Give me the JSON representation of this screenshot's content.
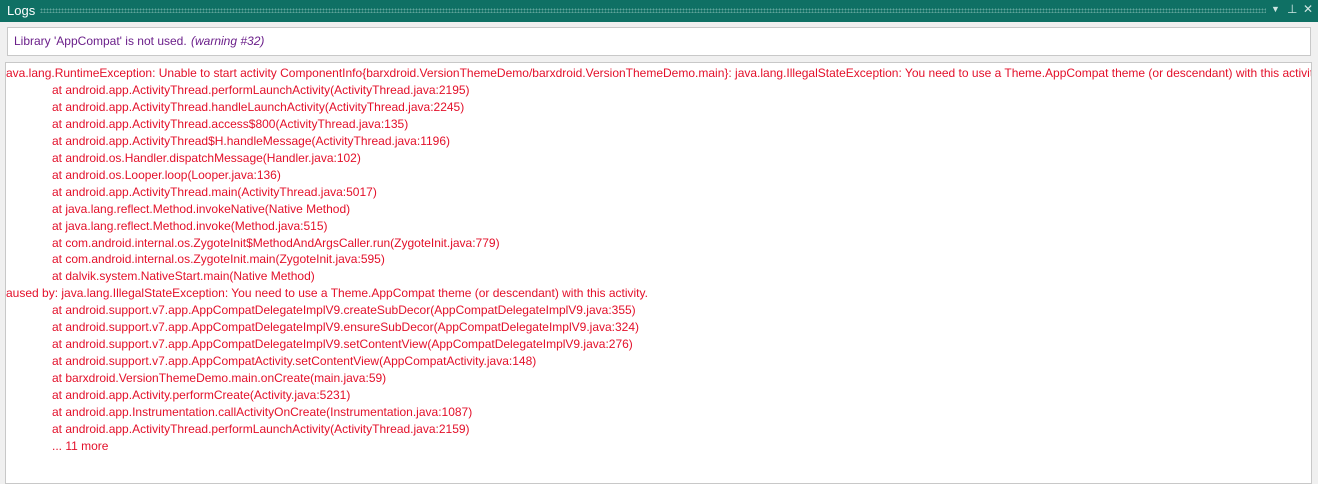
{
  "panel": {
    "title": "Logs"
  },
  "warning": {
    "text": "Library 'AppCompat' is not used.",
    "code": "(warning #32)"
  },
  "log": {
    "lines": [
      {
        "t": "ava.lang.RuntimeException: Unable to start activity ComponentInfo{barxdroid.VersionThemeDemo/barxdroid.VersionThemeDemo.main}: java.lang.IllegalStateException: You need to use a Theme.AppCompat theme (or descendant) with this activity.",
        "ind": false
      },
      {
        "t": "at android.app.ActivityThread.performLaunchActivity(ActivityThread.java:2195)",
        "ind": true
      },
      {
        "t": "at android.app.ActivityThread.handleLaunchActivity(ActivityThread.java:2245)",
        "ind": true
      },
      {
        "t": "at android.app.ActivityThread.access$800(ActivityThread.java:135)",
        "ind": true
      },
      {
        "t": "at android.app.ActivityThread$H.handleMessage(ActivityThread.java:1196)",
        "ind": true
      },
      {
        "t": "at android.os.Handler.dispatchMessage(Handler.java:102)",
        "ind": true
      },
      {
        "t": "at android.os.Looper.loop(Looper.java:136)",
        "ind": true
      },
      {
        "t": "at android.app.ActivityThread.main(ActivityThread.java:5017)",
        "ind": true
      },
      {
        "t": "at java.lang.reflect.Method.invokeNative(Native Method)",
        "ind": true
      },
      {
        "t": "at java.lang.reflect.Method.invoke(Method.java:515)",
        "ind": true
      },
      {
        "t": "at com.android.internal.os.ZygoteInit$MethodAndArgsCaller.run(ZygoteInit.java:779)",
        "ind": true
      },
      {
        "t": "at com.android.internal.os.ZygoteInit.main(ZygoteInit.java:595)",
        "ind": true
      },
      {
        "t": "at dalvik.system.NativeStart.main(Native Method)",
        "ind": true
      },
      {
        "t": "aused by: java.lang.IllegalStateException: You need to use a Theme.AppCompat theme (or descendant) with this activity.",
        "ind": false
      },
      {
        "t": "at android.support.v7.app.AppCompatDelegateImplV9.createSubDecor(AppCompatDelegateImplV9.java:355)",
        "ind": true
      },
      {
        "t": "at android.support.v7.app.AppCompatDelegateImplV9.ensureSubDecor(AppCompatDelegateImplV9.java:324)",
        "ind": true
      },
      {
        "t": "at android.support.v7.app.AppCompatDelegateImplV9.setContentView(AppCompatDelegateImplV9.java:276)",
        "ind": true
      },
      {
        "t": "at android.support.v7.app.AppCompatActivity.setContentView(AppCompatActivity.java:148)",
        "ind": true
      },
      {
        "t": "at barxdroid.VersionThemeDemo.main.onCreate(main.java:59)",
        "ind": true
      },
      {
        "t": "at android.app.Activity.performCreate(Activity.java:5231)",
        "ind": true
      },
      {
        "t": "at android.app.Instrumentation.callActivityOnCreate(Instrumentation.java:1087)",
        "ind": true
      },
      {
        "t": "at android.app.ActivityThread.performLaunchActivity(ActivityThread.java:2159)",
        "ind": true
      },
      {
        "t": "... 11 more",
        "ind": true
      }
    ]
  }
}
